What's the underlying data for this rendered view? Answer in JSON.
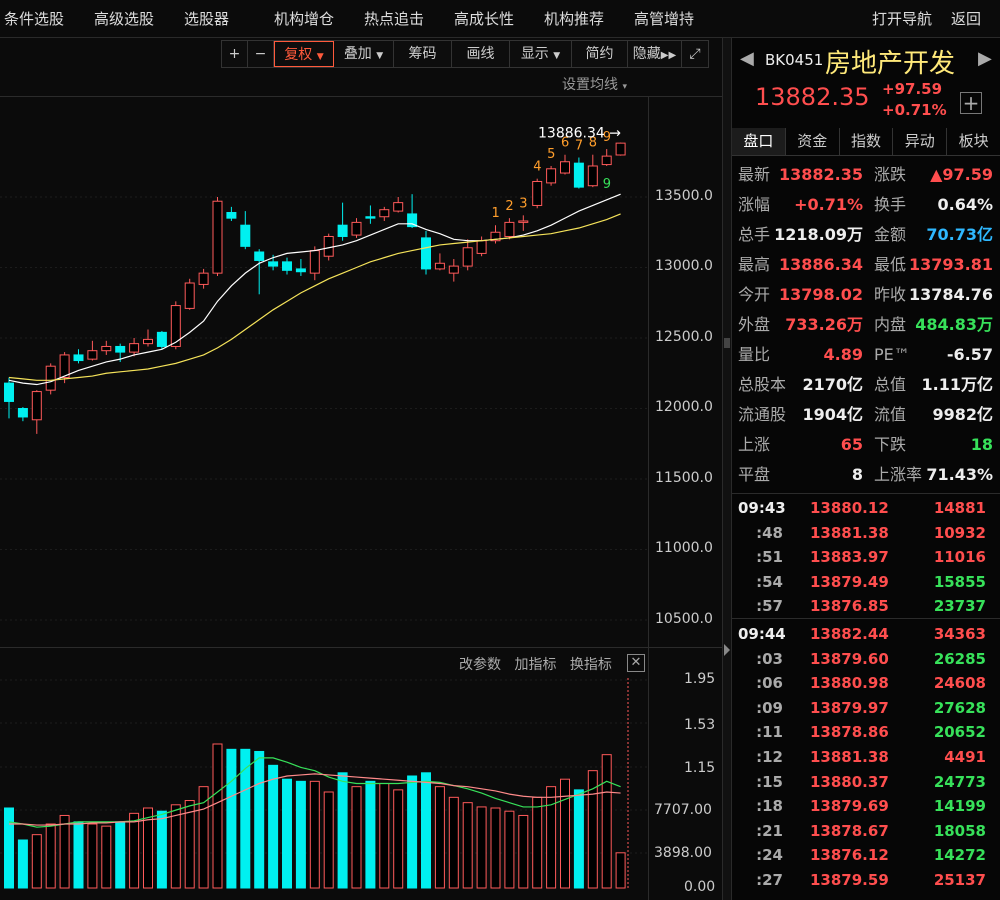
{
  "nav": {
    "items": [
      "条件选股",
      "高级选股",
      "选股器",
      "机构增仓",
      "热点追击",
      "高成长性",
      "机构推荐",
      "高管增持"
    ],
    "right": [
      "打开导航",
      "返回"
    ]
  },
  "toolbar": {
    "zoom_in": "+",
    "zoom_out": "−",
    "fuquan": "复权",
    "overlay": "叠加",
    "chips": "筹码",
    "draw": "画线",
    "display": "显示",
    "simple": "简约",
    "hide": "隐藏",
    "ma_setting": "设置均线"
  },
  "chart": {
    "y_labels": [
      "13500.0",
      "13000.0",
      "12500.0",
      "12000.0",
      "11500.0",
      "11000.0",
      "10500.0"
    ],
    "max_marker": "13886.34",
    "td_counts": [
      "1",
      "2",
      "3",
      "4",
      "5",
      "6",
      "7",
      "8",
      "9"
    ],
    "td_nine": "9",
    "colors": {
      "up": "#ff5a5a",
      "down": "#00f0f0",
      "ma1": "#ffffff",
      "ma2": "#f5e35a",
      "td": "#ff9e2c",
      "td_nine": "#37e15a"
    }
  },
  "chart_data": {
    "type": "candlestick",
    "ylim": [
      10300,
      14050
    ],
    "candles": [
      [
        12180,
        12050,
        12220,
        11930,
        "d"
      ],
      [
        12000,
        11940,
        12010,
        11910,
        "d"
      ],
      [
        11920,
        12120,
        12130,
        11820,
        "u"
      ],
      [
        12130,
        12300,
        12320,
        12100,
        "u"
      ],
      [
        12220,
        12380,
        12400,
        12180,
        "u"
      ],
      [
        12380,
        12340,
        12420,
        12320,
        "d"
      ],
      [
        12350,
        12410,
        12480,
        12340,
        "u"
      ],
      [
        12410,
        12440,
        12480,
        12380,
        "u"
      ],
      [
        12440,
        12400,
        12460,
        12330,
        "d"
      ],
      [
        12400,
        12460,
        12500,
        12370,
        "u"
      ],
      [
        12460,
        12490,
        12560,
        12440,
        "u"
      ],
      [
        12540,
        12440,
        12550,
        12420,
        "d"
      ],
      [
        12440,
        12730,
        12760,
        12420,
        "u"
      ],
      [
        12710,
        12890,
        12920,
        12700,
        "u"
      ],
      [
        12880,
        12960,
        12990,
        12850,
        "u"
      ],
      [
        12960,
        13470,
        13500,
        12940,
        "u"
      ],
      [
        13390,
        13350,
        13430,
        13330,
        "d"
      ],
      [
        13300,
        13150,
        13400,
        13130,
        "d"
      ],
      [
        13110,
        13050,
        13130,
        12810,
        "d"
      ],
      [
        13040,
        13010,
        13090,
        12980,
        "d"
      ],
      [
        13040,
        12980,
        13070,
        12950,
        "d"
      ],
      [
        12990,
        12970,
        13060,
        12940,
        "d"
      ],
      [
        12960,
        13120,
        13150,
        12910,
        "u"
      ],
      [
        13080,
        13220,
        13240,
        13050,
        "u"
      ],
      [
        13300,
        13220,
        13460,
        13190,
        "d"
      ],
      [
        13230,
        13320,
        13350,
        13210,
        "u"
      ],
      [
        13360,
        13350,
        13440,
        13310,
        "d"
      ],
      [
        13360,
        13410,
        13430,
        13330,
        "u"
      ],
      [
        13400,
        13460,
        13500,
        13390,
        "u"
      ],
      [
        13380,
        13290,
        13520,
        13280,
        "d"
      ],
      [
        13210,
        12990,
        13260,
        12950,
        "d"
      ],
      [
        12990,
        13030,
        13100,
        12980,
        "u"
      ],
      [
        13010,
        12960,
        13060,
        12900,
        "u"
      ],
      [
        13010,
        13140,
        13200,
        12980,
        "u"
      ],
      [
        13100,
        13190,
        13220,
        13080,
        "u"
      ],
      [
        13190,
        13250,
        13300,
        13170,
        "u"
      ],
      [
        13220,
        13320,
        13350,
        13200,
        "u"
      ],
      [
        13330,
        13320,
        13370,
        13260,
        "u"
      ],
      [
        13440,
        13610,
        13630,
        13420,
        "u"
      ],
      [
        13600,
        13700,
        13720,
        13580,
        "u"
      ],
      [
        13670,
        13750,
        13800,
        13660,
        "u"
      ],
      [
        13740,
        13570,
        13780,
        13560,
        "d"
      ],
      [
        13580,
        13720,
        13800,
        13570,
        "u"
      ],
      [
        13730,
        13790,
        13840,
        13720,
        "u"
      ],
      [
        13798,
        13882,
        13886,
        13793,
        "u"
      ]
    ],
    "ma_white": [
      12200,
      12180,
      12170,
      12190,
      12230,
      12270,
      12300,
      12330,
      12350,
      12380,
      12400,
      12420,
      12470,
      12540,
      12620,
      12760,
      12870,
      12960,
      13030,
      13070,
      13100,
      13110,
      13120,
      13140,
      13160,
      13190,
      13230,
      13270,
      13310,
      13310,
      13270,
      13240,
      13200,
      13190,
      13190,
      13200,
      13210,
      13230,
      13260,
      13300,
      13350,
      13400,
      13440,
      13480,
      13520
    ],
    "ma_yellow": [
      12220,
      12210,
      12200,
      12200,
      12210,
      12220,
      12230,
      12250,
      12260,
      12270,
      12280,
      12300,
      12320,
      12350,
      12380,
      12430,
      12490,
      12560,
      12630,
      12700,
      12760,
      12820,
      12870,
      12920,
      12960,
      13000,
      13040,
      13070,
      13100,
      13120,
      13140,
      13160,
      13170,
      13180,
      13190,
      13200,
      13210,
      13220,
      13230,
      13240,
      13260,
      13280,
      13310,
      13340,
      13380
    ],
    "volume_ylim": [
      0,
      1.95
    ],
    "volumes": [
      0.75,
      0.45,
      0.5,
      0.6,
      0.68,
      0.62,
      0.6,
      0.58,
      0.62,
      0.7,
      0.75,
      0.72,
      0.78,
      0.82,
      0.95,
      1.35,
      1.3,
      1.3,
      1.28,
      1.15,
      1.02,
      1.0,
      1.0,
      0.9,
      1.08,
      0.95,
      1.0,
      0.98,
      0.92,
      1.05,
      1.08,
      0.95,
      0.85,
      0.8,
      0.76,
      0.75,
      0.72,
      0.68,
      0.85,
      0.95,
      1.02,
      0.92,
      1.1,
      1.25,
      0.33
    ],
    "vol_ma1": [
      0.62,
      0.6,
      0.57,
      0.58,
      0.6,
      0.62,
      0.62,
      0.62,
      0.62,
      0.63,
      0.66,
      0.69,
      0.73,
      0.77,
      0.8,
      0.9,
      1.0,
      1.12,
      1.22,
      1.22,
      1.18,
      1.13,
      1.1,
      1.04,
      1.0,
      0.98,
      0.98,
      0.98,
      0.98,
      0.99,
      1.0,
      0.99,
      0.96,
      0.93,
      0.89,
      0.84,
      0.8,
      0.76,
      0.76,
      0.78,
      0.83,
      0.88,
      0.93,
      1.0,
      0.95
    ],
    "vol_ma2": [
      0.6,
      0.6,
      0.59,
      0.59,
      0.6,
      0.6,
      0.61,
      0.61,
      0.62,
      0.62,
      0.64,
      0.65,
      0.68,
      0.71,
      0.74,
      0.8,
      0.86,
      0.92,
      0.98,
      1.02,
      1.05,
      1.06,
      1.07,
      1.06,
      1.05,
      1.04,
      1.03,
      1.02,
      1.01,
      1.0,
      0.99,
      0.98,
      0.96,
      0.95,
      0.93,
      0.91,
      0.88,
      0.86,
      0.85,
      0.85,
      0.86,
      0.87,
      0.88,
      0.9,
      0.89
    ]
  },
  "volume": {
    "y_labels": [
      "1.95",
      "1.53",
      "1.15",
      "7707.00",
      "3898.00",
      "0.00"
    ],
    "tools": [
      "改参数",
      "加指标",
      "换指标"
    ],
    "close": "✕"
  },
  "quote": {
    "code": "BK0451",
    "name": "房地产开发",
    "price": "13882.35",
    "change": "+97.59",
    "change_pct": "+0.71%",
    "plus": "+",
    "tabs": [
      "盘口",
      "资金",
      "指数",
      "异动",
      "板块"
    ],
    "rows": [
      {
        "l1": "最新",
        "v1": "13882.35",
        "c1": "red",
        "l2": "涨跌",
        "v2": "▲97.59",
        "c2": "red"
      },
      {
        "l1": "涨幅",
        "v1": "+0.71%",
        "c1": "red",
        "l2": "换手",
        "v2": "0.64%",
        "c2": "white"
      },
      {
        "l1": "总手",
        "v1": "1218.09万",
        "c1": "white",
        "l2": "金额",
        "v2": "70.73亿",
        "c2": "cyan"
      },
      {
        "l1": "最高",
        "v1": "13886.34",
        "c1": "red",
        "l2": "最低",
        "v2": "13793.81",
        "c2": "red"
      },
      {
        "l1": "今开",
        "v1": "13798.02",
        "c1": "red",
        "l2": "昨收",
        "v2": "13784.76",
        "c2": "white"
      },
      {
        "l1": "外盘",
        "v1": "733.26万",
        "c1": "red",
        "l2": "内盘",
        "v2": "484.83万",
        "c2": "green"
      },
      {
        "l1": "量比",
        "v1": "4.89",
        "c1": "red",
        "l2": "PE™",
        "v2": "-6.57",
        "c2": "white"
      },
      {
        "l1": "总股本",
        "v1": "2170亿",
        "c1": "white",
        "l2": "总值",
        "v2": "1.11万亿",
        "c2": "white"
      },
      {
        "l1": "流通股",
        "v1": "1904亿",
        "c1": "white",
        "l2": "流值",
        "v2": "9982亿",
        "c2": "white"
      },
      {
        "l1": "上涨",
        "v1": "65",
        "c1": "red",
        "l2": "下跌",
        "v2": "18",
        "c2": "green"
      },
      {
        "l1": "平盘",
        "v1": "8",
        "c1": "white",
        "l2": "上涨率",
        "v2": "71.43%",
        "c2": "white"
      }
    ]
  },
  "ticks": [
    {
      "t": "09:43",
      "p": "13880.12",
      "v": "14881",
      "vc": "red"
    },
    {
      "t": ":48",
      "p": "13881.38",
      "v": "10932",
      "vc": "red"
    },
    {
      "t": ":51",
      "p": "13883.97",
      "v": "11016",
      "vc": "red"
    },
    {
      "t": ":54",
      "p": "13879.49",
      "v": "15855",
      "vc": "green"
    },
    {
      "t": ":57",
      "p": "13876.85",
      "v": "23737",
      "vc": "green"
    },
    {
      "t": "09:44",
      "p": "13882.44",
      "v": "34363",
      "vc": "red"
    },
    {
      "t": ":03",
      "p": "13879.60",
      "v": "26285",
      "vc": "green"
    },
    {
      "t": ":06",
      "p": "13880.98",
      "v": "24608",
      "vc": "red"
    },
    {
      "t": ":09",
      "p": "13879.97",
      "v": "27628",
      "vc": "green"
    },
    {
      "t": ":11",
      "p": "13878.86",
      "v": "20652",
      "vc": "green"
    },
    {
      "t": ":12",
      "p": "13881.38",
      "v": "4491",
      "vc": "red"
    },
    {
      "t": ":15",
      "p": "13880.37",
      "v": "24773",
      "vc": "green"
    },
    {
      "t": ":18",
      "p": "13879.69",
      "v": "14199",
      "vc": "green"
    },
    {
      "t": ":21",
      "p": "13878.67",
      "v": "18058",
      "vc": "green"
    },
    {
      "t": ":24",
      "p": "13876.12",
      "v": "14272",
      "vc": "green"
    },
    {
      "t": ":27",
      "p": "13879.59",
      "v": "25137",
      "vc": "red"
    }
  ]
}
